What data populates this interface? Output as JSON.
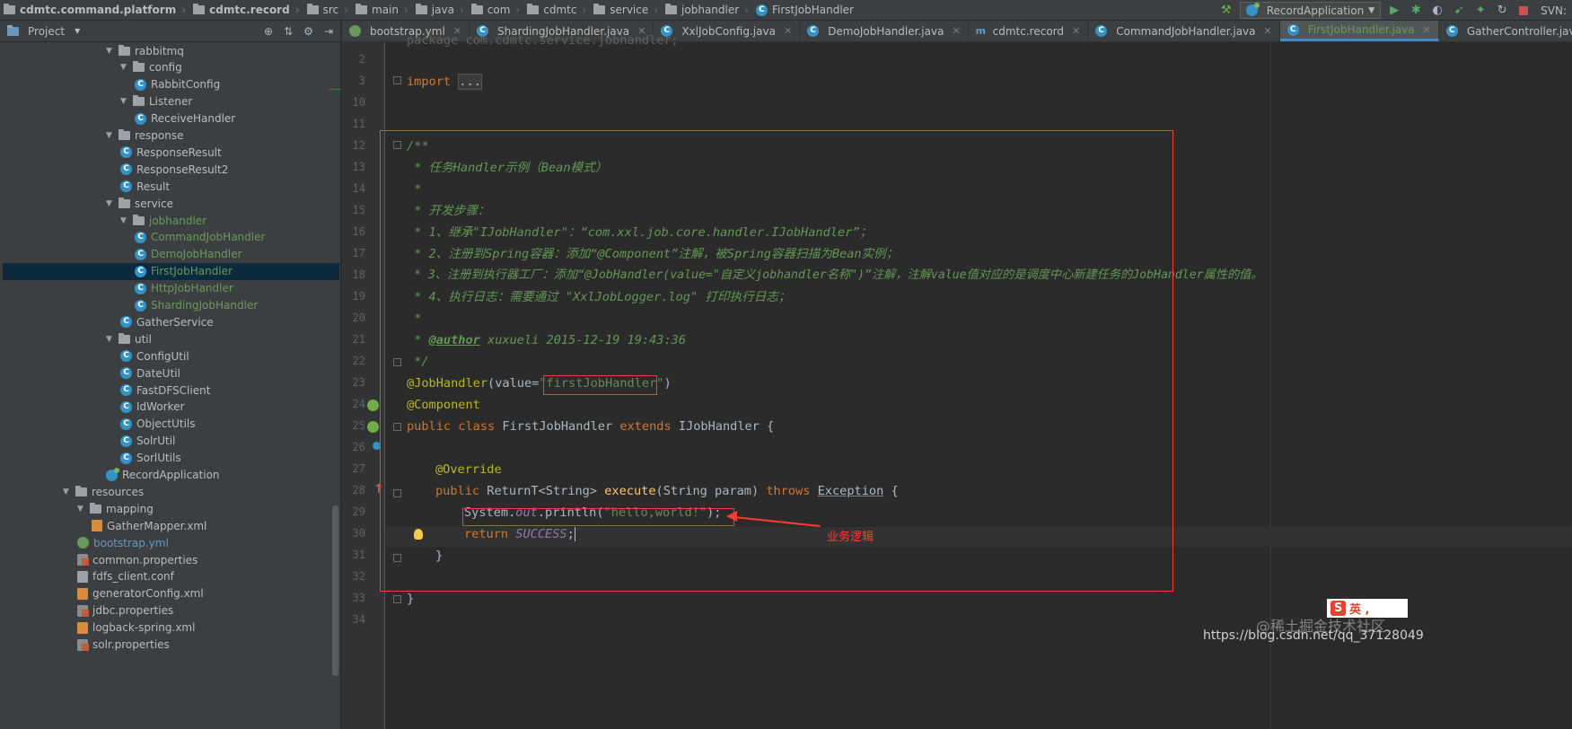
{
  "breadcrumb": [
    {
      "label": "cdmtc.command.platform",
      "icon": "folder-icon"
    },
    {
      "label": "cdmtc.record",
      "icon": "folder-icon"
    },
    {
      "label": "src",
      "icon": "folder-icon"
    },
    {
      "label": "main",
      "icon": "folder-icon"
    },
    {
      "label": "java",
      "icon": "folder-icon"
    },
    {
      "label": "com",
      "icon": "folder-icon"
    },
    {
      "label": "cdmtc",
      "icon": "folder-icon"
    },
    {
      "label": "service",
      "icon": "folder-icon"
    },
    {
      "label": "jobhandler",
      "icon": "folder-icon"
    },
    {
      "label": "FirstJobHandler",
      "icon": "class-icon"
    }
  ],
  "toolbar": {
    "run_config": "RecordApplication",
    "svn_label": "SVN:"
  },
  "project_panel": {
    "title": "Project",
    "tree": [
      {
        "label": "rabbitmq",
        "type": "folder",
        "expanded": true
      },
      {
        "label": "config",
        "type": "folder",
        "expanded": true
      },
      {
        "label": "RabbitConfig",
        "type": "class"
      },
      {
        "label": "Listener",
        "type": "folder",
        "expanded": true
      },
      {
        "label": "ReceiveHandler",
        "type": "class"
      },
      {
        "label": "response",
        "type": "folder",
        "expanded": true
      },
      {
        "label": "ResponseResult",
        "type": "class"
      },
      {
        "label": "ResponseResult2",
        "type": "class"
      },
      {
        "label": "Result",
        "type": "class"
      },
      {
        "label": "service",
        "type": "folder",
        "expanded": true
      },
      {
        "label": "jobhandler",
        "type": "folder",
        "expanded": true,
        "color": "green"
      },
      {
        "label": "CommandJobHandler",
        "type": "class",
        "color": "green"
      },
      {
        "label": "DemoJobHandler",
        "type": "class",
        "color": "green"
      },
      {
        "label": "FirstJobHandler",
        "type": "class",
        "color": "green",
        "selected": true
      },
      {
        "label": "HttpJobHandler",
        "type": "class",
        "color": "green"
      },
      {
        "label": "ShardingJobHandler",
        "type": "class",
        "color": "green"
      },
      {
        "label": "GatherService",
        "type": "class"
      },
      {
        "label": "util",
        "type": "folder",
        "expanded": true
      },
      {
        "label": "ConfigUtil",
        "type": "class"
      },
      {
        "label": "DateUtil",
        "type": "class"
      },
      {
        "label": "FastDFSClient",
        "type": "class"
      },
      {
        "label": "IdWorker",
        "type": "class"
      },
      {
        "label": "ObjectUtils",
        "type": "class"
      },
      {
        "label": "SolrUtil",
        "type": "class"
      },
      {
        "label": "SorlUtils",
        "type": "class"
      },
      {
        "label": "RecordApplication",
        "type": "spring-class"
      },
      {
        "label": "resources",
        "type": "folder",
        "expanded": true
      },
      {
        "label": "mapping",
        "type": "folder",
        "expanded": true
      },
      {
        "label": "GatherMapper.xml",
        "type": "xml"
      },
      {
        "label": "bootstrap.yml",
        "type": "yml",
        "color": "blue"
      },
      {
        "label": "common.properties",
        "type": "properties"
      },
      {
        "label": "fdfs_client.conf",
        "type": "conf"
      },
      {
        "label": "generatorConfig.xml",
        "type": "xml"
      },
      {
        "label": "jdbc.properties",
        "type": "properties"
      },
      {
        "label": "logback-spring.xml",
        "type": "xml"
      },
      {
        "label": "solr.properties",
        "type": "properties"
      }
    ]
  },
  "tabs": [
    {
      "label": "bootstrap.yml"
    },
    {
      "label": "ShardingJobHandler.java"
    },
    {
      "label": "XxlJobConfig.java"
    },
    {
      "label": "DemoJobHandler.java"
    },
    {
      "label": "cdmtc.record"
    },
    {
      "label": "CommandJobHandler.java"
    },
    {
      "label": "FirstJobHandler.java",
      "active": true
    },
    {
      "label": "GatherController.java"
    }
  ],
  "editor": {
    "line_numbers": [
      "2",
      "3",
      "10",
      "11",
      "12",
      "13",
      "14",
      "15",
      "16",
      "17",
      "18",
      "19",
      "20",
      "21",
      "22",
      "23",
      "24",
      "25",
      "26",
      "27",
      "28",
      "29",
      "30",
      "31",
      "32",
      "33",
      "34"
    ],
    "code": {
      "l1_pkg": "package com.cdmtc.service.jobhandler;",
      "l3_import": "import",
      "l3_dots": "...",
      "l12": "/**",
      "l13": " * 任务Handler示例（Bean模式）",
      "l14": " *",
      "l15": " * 开发步骤：",
      "l16": " * 1、继承\"IJobHandler\"：“com.xxl.job.core.handler.IJobHandler”；",
      "l17": " * 2、注册到Spring容器：添加“@Component”注解，被Spring容器扫描为Bean实例；",
      "l18": " * 3、注册到执行器工厂：添加“@JobHandler(value=\"自定义jobhandler名称\")”注解，注解value值对应的是调度中心新建任务的JobHandler属性的值。",
      "l19": " * 4、执行日志：需要通过 \"XxlJobLogger.log\" 打印执行日志；",
      "l20": " *",
      "l21_star": " * ",
      "l21_tag": "@author",
      "l21_rest": " xuxueli 2015-12-19 19:43:36",
      "l22": " */",
      "l23_ann": "@JobHandler",
      "l23_open": "(value=",
      "l23_str": "\"firstJobHandler\"",
      "l23_close": ")",
      "l24": "@Component",
      "l25_kw": "public class",
      "l25_name": " FirstJobHandler ",
      "l25_ext": "extends",
      "l25_rest": " IJobHandler {",
      "l27": "@Override",
      "l28_kw": "public",
      "l28_type": " ReturnT<String> ",
      "l28_fn": "execute",
      "l28_args": "(String param) ",
      "l28_throws": "throws",
      "l28_exc": "Exception",
      "l28_brace": " {",
      "l29_a": "System.",
      "l29_out": "out",
      "l29_b": ".println(",
      "l29_str": "\"hello,world!\"",
      "l29_c": ");",
      "l30_kw": "return",
      "l30_val": "SUCCESS",
      "l30_semi": ";",
      "l31": "}",
      "l33": "}"
    }
  },
  "annotation_label": "业务逻辑",
  "ime": {
    "badge": "S",
    "text": "英 ,"
  },
  "watermark": {
    "line1": "@稀土掘金技术社区",
    "line2": "https://blog.csdn.net/qq_37128049"
  },
  "colors": {
    "accent": "#4a88c7",
    "annotation_red": "#ff3b30"
  }
}
